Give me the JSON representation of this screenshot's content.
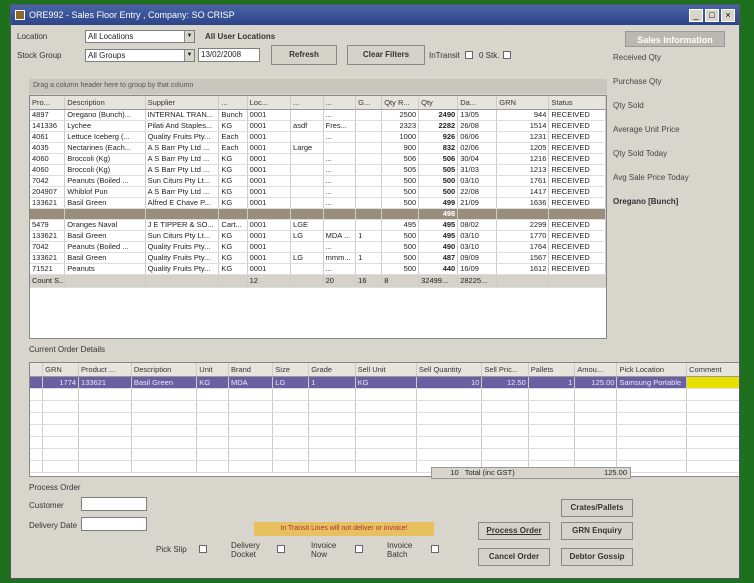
{
  "window": {
    "title": "ORE992 - Sales Floor Entry , Company: SO CRISP",
    "min": "_",
    "max": "□",
    "close": "×"
  },
  "filters": {
    "location_label": "Location",
    "location_value": "All Locations",
    "all_user_locations": "All User Locations",
    "stock_group_label": "Stock Group",
    "stock_group_value": "All Groups",
    "date_value": "13/02/2008",
    "refresh": "Refresh",
    "clear_filters": "Clear Filters",
    "in_transit": "InTransit",
    "zero_stk": "0 Stk."
  },
  "group_hint": "Drag a column header here to group by that column",
  "main_grid": {
    "columns": [
      "Pro...",
      "Description",
      "Supplier",
      "...",
      "Loc...",
      "...",
      "...",
      "G...",
      "Qty R...",
      "Qty",
      "Da...",
      "GRN",
      "Status"
    ],
    "rows": [
      [
        "4897",
        "Oregano (Bunch)...",
        "INTERNAL TRAN...",
        "Bunch",
        "0001",
        "",
        "...",
        "",
        "2500",
        "2490",
        "13/05",
        "944",
        "RECEIVED"
      ],
      [
        "141336",
        "Lychee",
        "Pilati And Staples...",
        "KG",
        "0001",
        "asdf",
        "Fres...",
        "",
        "2323",
        "2282",
        "26/08",
        "1514",
        "RECEIVED"
      ],
      [
        "4061",
        "Lettuce Iceberg (...",
        "Quality Fruits Pty...",
        "Each",
        "0001",
        "",
        "...",
        "",
        "1000",
        "926",
        "06/06",
        "1231",
        "RECEIVED"
      ],
      [
        "4035",
        "Nectarines (Each...",
        "A S Barr Pty Ltd ...",
        "Each",
        "0001",
        "Large",
        "",
        "",
        "900",
        "832",
        "02/06",
        "1205",
        "RECEIVED"
      ],
      [
        "4060",
        "Broccoli (Kg)",
        "A S Barr Pty Ltd ...",
        "KG",
        "0001",
        "",
        "...",
        "",
        "506",
        "506",
        "30/04",
        "1216",
        "RECEIVED"
      ],
      [
        "4060",
        "Broccoli (Kg)",
        "A S Barr Pty Ltd ...",
        "KG",
        "0001",
        "",
        "...",
        "",
        "505",
        "505",
        "31/03",
        "1213",
        "RECEIVED"
      ],
      [
        "7042",
        "Peanuts (Boiled ...",
        "Sun Citurs Pty Lt...",
        "KG",
        "0001",
        "",
        "...",
        "",
        "500",
        "500",
        "03/10",
        "1761",
        "RECEIVED"
      ],
      [
        "204907",
        "Whiblof Pun",
        "A S Barr Pty Ltd ...",
        "KG",
        "0001",
        "",
        "...",
        "",
        "500",
        "500",
        "22/08",
        "1417",
        "RECEIVED"
      ],
      [
        "133621",
        "Basil Green",
        "Alfred E Chave P...",
        "KG",
        "0001",
        "",
        "...",
        "",
        "500",
        "499",
        "21/09",
        "1636",
        "RECEIVED"
      ],
      [
        "",
        "",
        "",
        "",
        "",
        "",
        "",
        "",
        "",
        "498",
        "",
        "",
        ""
      ],
      [
        "5479",
        "Oranges Naval",
        "J E TIPPER & SO...",
        "Cart...",
        "0001",
        "LGE",
        "",
        "",
        "495",
        "495",
        "08/02",
        "2299",
        "RECEIVED"
      ],
      [
        "133621",
        "Basil Green",
        "Sun Citurs Pty Lt...",
        "KG",
        "0001",
        "LG",
        "MDA ...",
        "1",
        "500",
        "495",
        "03/10",
        "1770",
        "RECEIVED"
      ],
      [
        "7042",
        "Peanuts (Boiled ...",
        "Quality Fruits Pty...",
        "KG",
        "0001",
        "",
        "...",
        "",
        "500",
        "490",
        "03/10",
        "1764",
        "RECEIVED"
      ],
      [
        "133621",
        "Basil Green",
        "Quality Fruits Pty...",
        "KG",
        "0001",
        "LG",
        "mmm...",
        "1",
        "500",
        "487",
        "09/09",
        "1567",
        "RECEIVED"
      ],
      [
        "71521",
        "Peanuts",
        "Quality Fruits Pty...",
        "KG",
        "0001",
        "",
        "...",
        "",
        "500",
        "440",
        "16/09",
        "1612",
        "RECEIVED"
      ]
    ],
    "footer": [
      "Count S...",
      "",
      "",
      "",
      "12",
      "",
      "20",
      "16",
      "8",
      "32499...",
      "28225...",
      "",
      ""
    ]
  },
  "right_panel": {
    "header": "Sales Information",
    "items": [
      "Received Qty",
      "Purchase Qty",
      "Qty Sold",
      "Average Unit Price",
      "Qty Sold Today",
      "Avg Sale Price Today"
    ],
    "product": "Oregano [Bunch]"
  },
  "order_details": {
    "title": "Current Order Details",
    "columns": [
      "GRN",
      "Product ...",
      "Description",
      "Unit",
      "Brand",
      "Size",
      "Grade",
      "Sell Unit",
      "Sell Quantity",
      "Sell Pric...",
      "Pallets",
      "Amou...",
      "Pick Location",
      "Comment"
    ],
    "rows": [
      [
        "1774",
        "133621",
        "Basil Green",
        "KG",
        "MDA",
        "LG",
        "1",
        "KG",
        "10",
        "12.50",
        "1",
        "125.00",
        "Samsung Portable",
        ""
      ]
    ],
    "total_qty": "10",
    "total_label": "Total (inc GST)",
    "total_amount": "125.00"
  },
  "process": {
    "title": "Process Order",
    "customer_label": "Customer",
    "delivery_label": "Delivery Date",
    "warning": "In Transit Lines will not deliver or invoice!",
    "pick_slip": "Pick Slip",
    "delivery_docket": "Delivery Docket",
    "invoice_now": "Invoice Now",
    "invoice_batch": "Invoice Batch",
    "process_order": "Process Order",
    "cancel_order": "Cancel Order",
    "crates_pallets": "Crates/Pallets",
    "grn_enquiry": "GRN Enquiry",
    "debtor_gossip": "Debtor Gossip"
  }
}
